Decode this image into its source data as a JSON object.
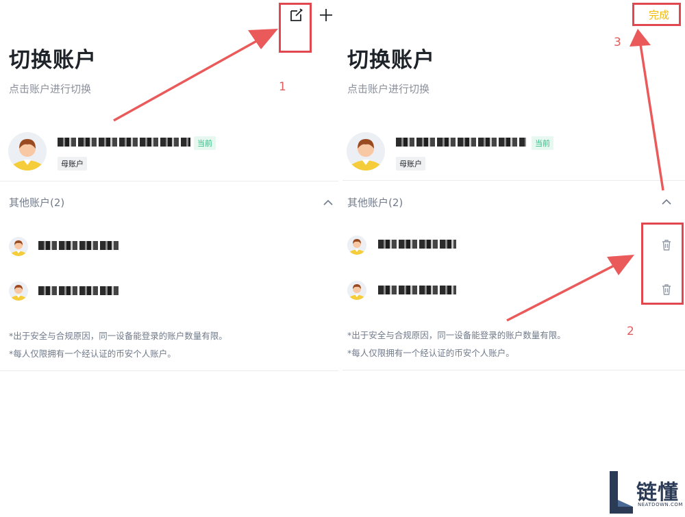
{
  "left": {
    "title": "切换账户",
    "subtitle": "点击账户进行切换",
    "current_badge": "当前",
    "main_badge": "母账户",
    "other_accounts_label": "其他账户(2)",
    "notes": [
      "*出于安全与合规原因，同一设备能登录的账户数量有限。",
      "*每人仅限拥有一个经认证的币安个人账户。"
    ]
  },
  "right": {
    "title": "切换账户",
    "subtitle": "点击账户进行切换",
    "current_badge": "当前",
    "main_badge": "母账户",
    "other_accounts_label": "其他账户(2)",
    "done_label": "完成",
    "notes": [
      "*出于安全与合规原因，同一设备能登录的账户数量有限。",
      "*每人仅限拥有一个经认证的币安个人账户。"
    ]
  },
  "annotations": {
    "step1": "1",
    "step2": "2",
    "step3": "3"
  },
  "logo": {
    "text": "链懂",
    "subtext": "NEATDOWN.COM"
  },
  "colors": {
    "accent_done": "#f0b90b",
    "current_badge": "#2ebd85",
    "annotation_red": "#e0474f"
  },
  "icons": {
    "edit": "edit-icon",
    "add": "plus-icon",
    "collapse": "chevron-up-icon",
    "delete": "trash-icon"
  }
}
